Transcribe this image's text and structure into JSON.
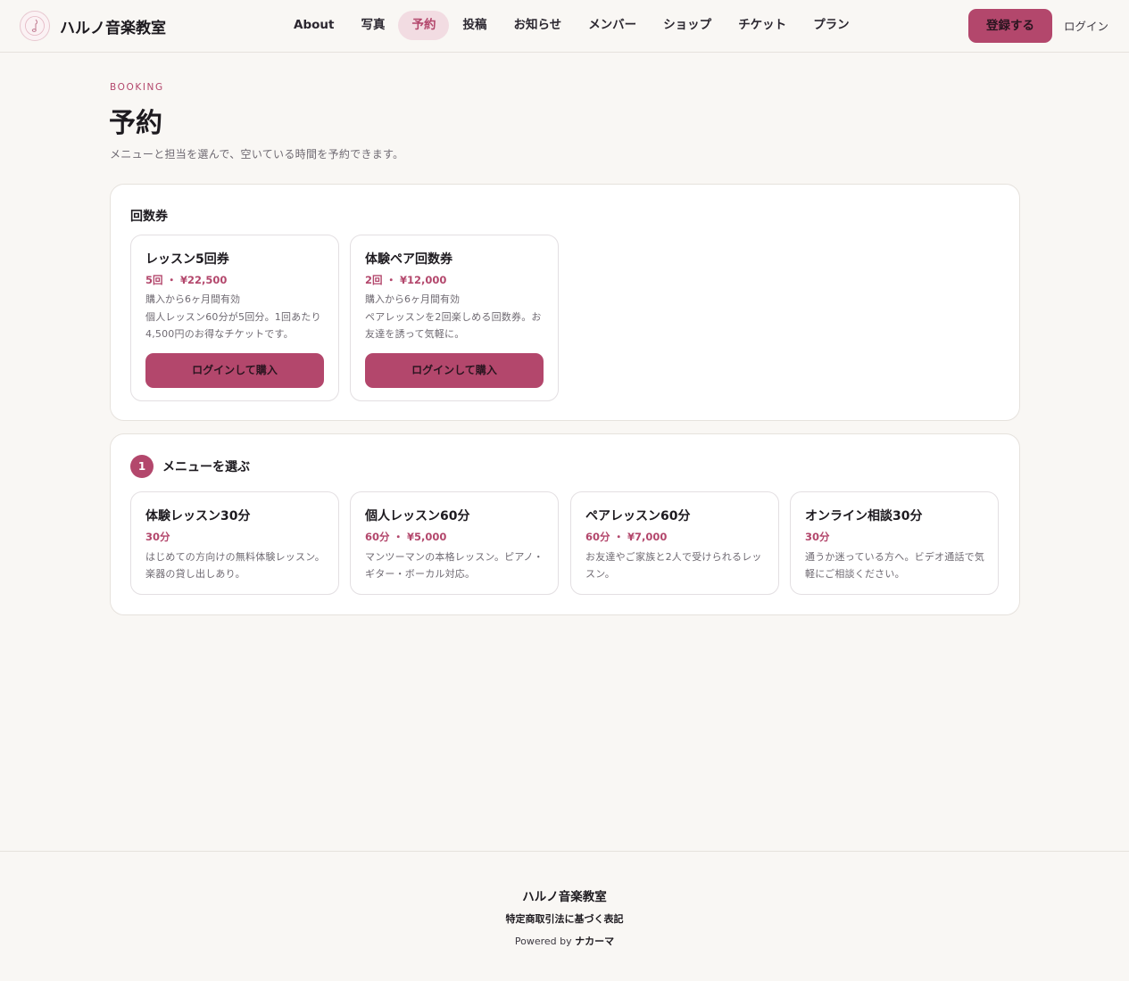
{
  "header": {
    "brand": "ハルノ音楽教室",
    "nav": [
      {
        "label": "About",
        "active": false
      },
      {
        "label": "写真",
        "active": false
      },
      {
        "label": "予約",
        "active": true
      },
      {
        "label": "投稿",
        "active": false
      },
      {
        "label": "お知らせ",
        "active": false
      },
      {
        "label": "メンバー",
        "active": false
      },
      {
        "label": "ショップ",
        "active": false
      },
      {
        "label": "チケット",
        "active": false
      },
      {
        "label": "プラン",
        "active": false
      }
    ],
    "signup_label": "登録する",
    "login_label": "ログイン"
  },
  "page": {
    "eyebrow": "BOOKING",
    "title": "予約",
    "description": "メニューと担当を選んで、空いている時間を予約できます。"
  },
  "tickets": {
    "title": "回数券",
    "items": [
      {
        "name": "レッスン5回券",
        "meta": "5回 ・ ¥22,500",
        "validity": "購入から6ヶ月間有効",
        "description": "個人レッスン60分が5回分。1回あたり4,500円のお得なチケットです。",
        "button": "ログインして購入"
      },
      {
        "name": "体験ペア回数券",
        "meta": "2回 ・ ¥12,000",
        "validity": "購入から6ヶ月間有効",
        "description": "ペアレッスンを2回楽しめる回数券。お友達を誘って気軽に。",
        "button": "ログインして購入"
      }
    ]
  },
  "menu": {
    "step": "1",
    "title": "メニューを選ぶ",
    "items": [
      {
        "name": "体験レッスン30分",
        "meta": "30分",
        "description": "はじめての方向けの無料体験レッスン。楽器の貸し出しあり。"
      },
      {
        "name": "個人レッスン60分",
        "meta": "60分 ・ ¥5,000",
        "description": "マンツーマンの本格レッスン。ピアノ・ギター・ボーカル対応。"
      },
      {
        "name": "ペアレッスン60分",
        "meta": "60分 ・ ¥7,000",
        "description": "お友達やご家族と2人で受けられるレッスン。"
      },
      {
        "name": "オンライン相談30分",
        "meta": "30分",
        "description": "通うか迷っている方へ。ビデオ通話で気軽にご相談ください。"
      }
    ]
  },
  "footer": {
    "brand": "ハルノ音楽教室",
    "legal_link": "特定商取引法に基づく表記",
    "powered_prefix": "Powered by",
    "powered_name": "ナカーマ"
  },
  "colors": {
    "accent": "#b3476c",
    "accent_soft": "#f2dce2",
    "background": "#f9f7f4",
    "card": "#ffffff",
    "border": "#e6e2dd"
  },
  "icons": {
    "logo": "music-note-icon"
  }
}
